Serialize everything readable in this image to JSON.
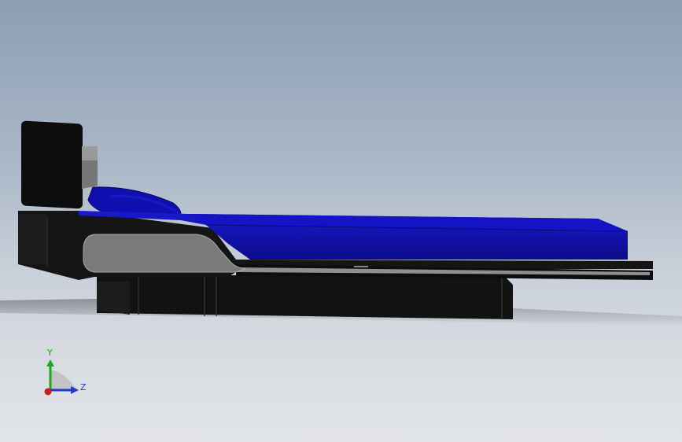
{
  "viewport": {
    "background_top": "#8c9eb4",
    "background_bottom": "#e2e4e7"
  },
  "model": {
    "mattress_color": "#1010b8",
    "frame_color": "#111111",
    "panel_color": "#7a7a7a"
  },
  "triad": {
    "y_label": "Y",
    "z_label": "Z",
    "y_color": "#1fa51f",
    "z_color": "#1e3ec8",
    "x_color": "#c81e1e"
  }
}
